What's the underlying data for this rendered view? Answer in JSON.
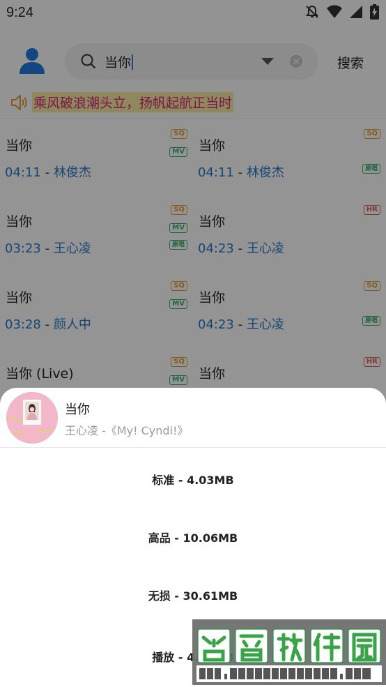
{
  "status_bar": {
    "time": "9:24"
  },
  "search": {
    "query": "当你",
    "button_label": "搜索"
  },
  "notice": {
    "text": "乘风破浪潮头立，扬帆起航正当时"
  },
  "results": [
    {
      "title": "当你",
      "duration": "04:11",
      "artist": "林俊杰",
      "badges": [
        "SQ",
        "MV"
      ]
    },
    {
      "title": "当你",
      "duration": "04:11",
      "artist": "林俊杰",
      "badges": [
        "SQ",
        "原唱"
      ]
    },
    {
      "title": "当你",
      "duration": "03:23",
      "artist": "王心凌",
      "badges": [
        "SQ",
        "MV",
        "原唱"
      ]
    },
    {
      "title": "当你",
      "duration": "04:23",
      "artist": "王心凌",
      "badges": [
        "HR"
      ]
    },
    {
      "title": "当你",
      "duration": "03:28",
      "artist": "颜人中",
      "badges": [
        "SQ",
        "MV"
      ]
    },
    {
      "title": "当你",
      "duration": "04:23",
      "artist": "王心凌",
      "badges": [
        "SQ",
        "原唱"
      ]
    },
    {
      "title": "当你 (Live)",
      "duration": "",
      "artist": "",
      "badges": [
        "SQ",
        "MV"
      ]
    },
    {
      "title": "当你",
      "duration": "",
      "artist": "",
      "badges": [
        "HR"
      ]
    }
  ],
  "sheet": {
    "song_title": "当你",
    "song_info": "王心凌 -《My! Cyndi!》",
    "options": [
      "标准 - 4.03MB",
      "高品 - 10.06MB",
      "无损 - 30.61MB",
      "播放 - 4.03MB"
    ]
  },
  "watermark": {
    "title": "谷普软件园",
    "url": "www.gupuxlazai.com"
  }
}
